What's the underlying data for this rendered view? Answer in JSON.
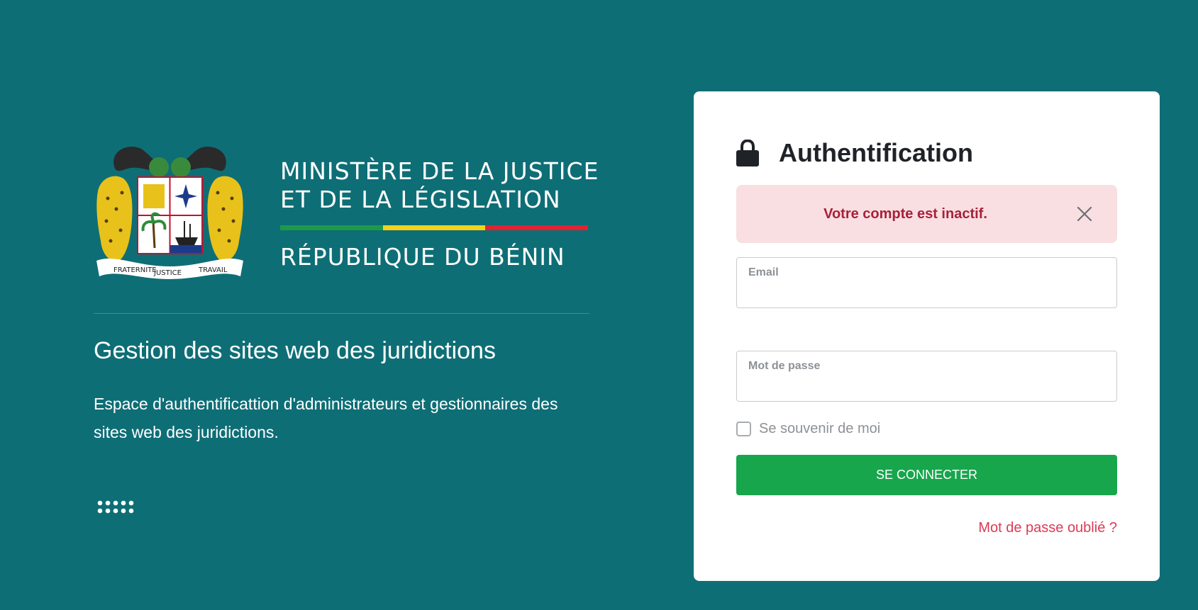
{
  "branding": {
    "motto_words": [
      "FRATERNITE",
      "JUSTICE",
      "TRAVAIL"
    ],
    "ministry_line1": "MINISTÈRE DE LA JUSTICE",
    "ministry_line2": "ET DE LA LÉGISLATION",
    "republic": "RÉPUBLIQUE DU BÉNIN",
    "flag_colors": [
      "#1c9a47",
      "#f5d219",
      "#e3232f"
    ]
  },
  "intro": {
    "title": "Gestion des sites web des juridictions",
    "description": "Espace d'authentificattion d'administrateurs et gestionnaires des sites web des juridictions."
  },
  "login": {
    "title": "Authentification",
    "title_icon": "lock-icon",
    "alert_message": "Votre compte est inactif.",
    "alert_close_icon": "close-icon",
    "email_label": "Email",
    "email_value": "",
    "password_label": "Mot de passe",
    "password_value": "",
    "remember_label": "Se souvenir de moi",
    "remember_checked": false,
    "submit_label": "SE CONNECTER",
    "forgot_label": "Mot de passe oublié ?"
  },
  "colors": {
    "background": "#0e6e76",
    "primary_button": "#17a64c",
    "alert_bg": "#f9dfe2",
    "alert_text": "#a8203a",
    "link": "#dc3a55"
  }
}
